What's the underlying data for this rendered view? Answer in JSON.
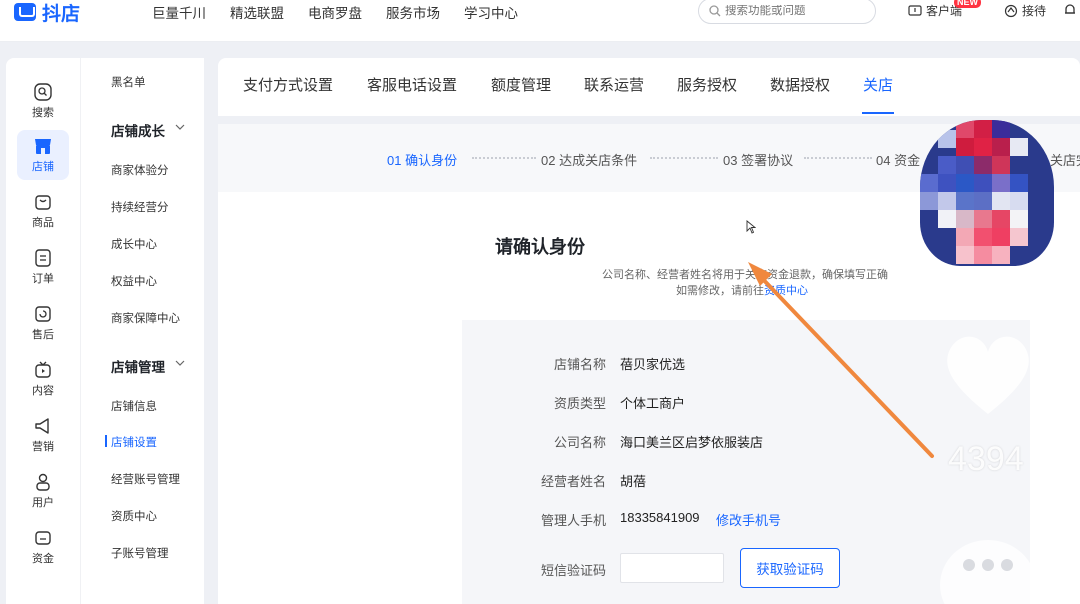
{
  "app": {
    "logo_text": "抖店"
  },
  "topnav": [
    "巨量千川",
    "精选联盟",
    "电商罗盘",
    "服务市场",
    "学习中心"
  ],
  "search": {
    "placeholder": "搜索功能或问题"
  },
  "top_right": {
    "customer_label": "客户端",
    "new_badge": "NEW",
    "reception_label": "接待"
  },
  "icon_sidebar": [
    {
      "label": "搜索",
      "icon": "search-icon"
    },
    {
      "label": "店铺",
      "icon": "store-icon",
      "active": true
    },
    {
      "label": "商品",
      "icon": "bag-icon"
    },
    {
      "label": "订单",
      "icon": "order-icon"
    },
    {
      "label": "售后",
      "icon": "after-sales-icon"
    },
    {
      "label": "内容",
      "icon": "tv-icon"
    },
    {
      "label": "营销",
      "icon": "megaphone-icon"
    },
    {
      "label": "用户",
      "icon": "user-icon"
    },
    {
      "label": "资金",
      "icon": "wallet-icon"
    }
  ],
  "submenu": {
    "top_item": "黑名单",
    "group1_title": "店铺成长",
    "group1_items": [
      "商家体验分",
      "持续经营分",
      "成长中心",
      "权益中心",
      "商家保障中心"
    ],
    "group2_title": "店铺管理",
    "group2_items": [
      "店铺信息",
      "店铺设置",
      "经营账号管理",
      "资质中心",
      "子账号管理"
    ]
  },
  "tabs": [
    "支付方式设置",
    "客服电话设置",
    "额度管理",
    "联系运营",
    "服务授权",
    "数据授权",
    "关店"
  ],
  "steps": [
    "01 确认身份",
    "02 达成关店条件",
    "03 签署协议",
    "04 资金",
    "关店完"
  ],
  "confirm": {
    "title": "请确认身份",
    "desc_line1": "公司名称、经营者姓名将用于关店资金退款，确保填写正确",
    "desc_line2_prefix": "如需修改，请前往",
    "desc_line2_link": "资质中心"
  },
  "info": {
    "shop_name_label": "店铺名称",
    "shop_name": "蓓贝家优选",
    "qual_type_label": "资质类型",
    "qual_type": "个体工商户",
    "company_label": "公司名称",
    "company": "海口美兰区启梦依服装店",
    "operator_label": "经营者姓名",
    "operator": "胡蓓",
    "phone_label": "管理人手机",
    "phone": "18335841909",
    "phone_link": "修改手机号",
    "sms_label": "短信验证码",
    "sms_button": "获取验证码"
  },
  "overlay": {
    "count": "4394"
  },
  "colors": {
    "accent": "#1966ff",
    "arrow": "#f0883e"
  }
}
